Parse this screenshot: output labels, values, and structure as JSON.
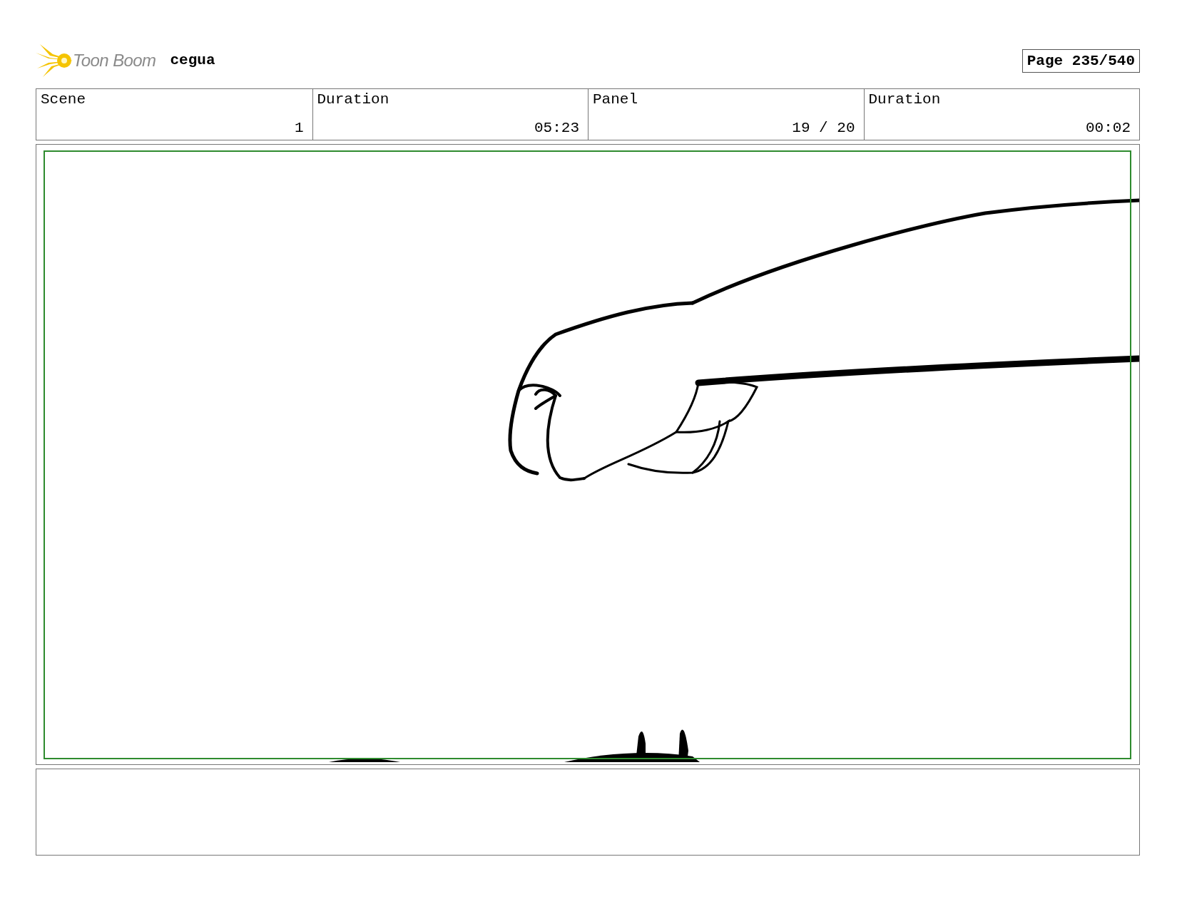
{
  "header": {
    "logo_text": "Toon Boom",
    "project": "cegua",
    "page": "Page 235/540"
  },
  "fields": [
    {
      "label": "Scene",
      "value": "1"
    },
    {
      "label": "Duration",
      "value": "05:23"
    },
    {
      "label": "Panel",
      "value": "19 / 20"
    },
    {
      "label": "Duration",
      "value": "00:02"
    }
  ]
}
